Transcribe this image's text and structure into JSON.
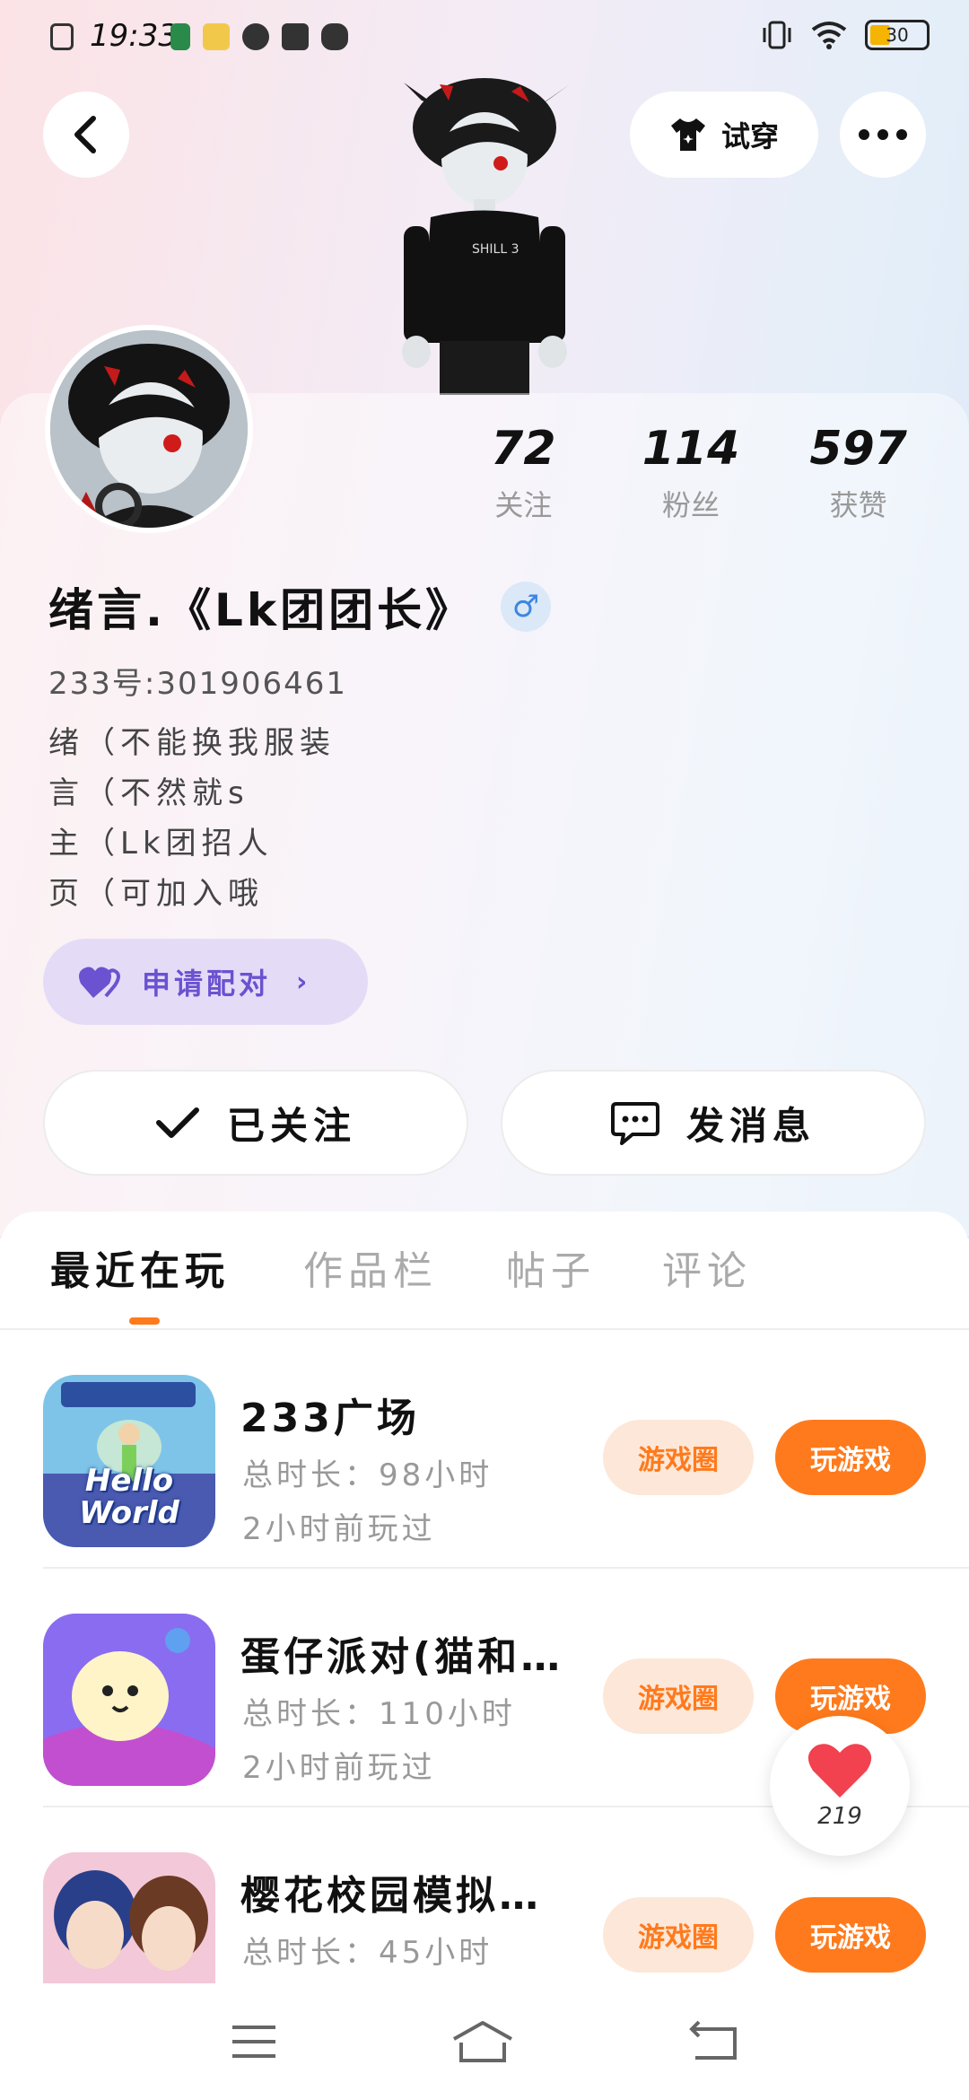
{
  "status_bar": {
    "time": "19:33",
    "battery": "30"
  },
  "header": {
    "tryon_label": "试穿"
  },
  "profile": {
    "stats": [
      {
        "value": "72",
        "label": "关注"
      },
      {
        "value": "114",
        "label": "粉丝"
      },
      {
        "value": "597",
        "label": "获赞"
      }
    ],
    "username": "绪言.《Lk团团长》",
    "gender_symbol": "♂",
    "uid": "233号:301906461",
    "bio": [
      "绪（不能换我服装",
      "言（不然就s",
      "主（Lk团招人",
      "页（可加入哦"
    ],
    "pair_label": "申请配对",
    "follow_label": "已关注",
    "message_label": "发消息"
  },
  "tabs": [
    {
      "label": "最近在玩",
      "active": true
    },
    {
      "label": "作品栏",
      "active": false
    },
    {
      "label": "帖子",
      "active": false
    },
    {
      "label": "评论",
      "active": false
    }
  ],
  "games": [
    {
      "title": "233广场",
      "duration": "总时长：98小时",
      "last_played": "2小时前玩过",
      "circle_label": "游戏圈",
      "play_label": "玩游戏",
      "icon_text": "Hello World"
    },
    {
      "title": "蛋仔派对(猫和…",
      "duration": "总时长：110小时",
      "last_played": "2小时前玩过",
      "circle_label": "游戏圈",
      "play_label": "玩游戏"
    },
    {
      "title": "樱花校园模拟…",
      "duration": "总时长：45小时",
      "last_played": "",
      "circle_label": "游戏圈",
      "play_label": "玩游戏"
    }
  ],
  "like_fab": {
    "count": "219"
  },
  "colors": {
    "accent": "#ff7a1c",
    "pair_purple": "#6a52d0",
    "gender_blue": "#3d86e0"
  }
}
